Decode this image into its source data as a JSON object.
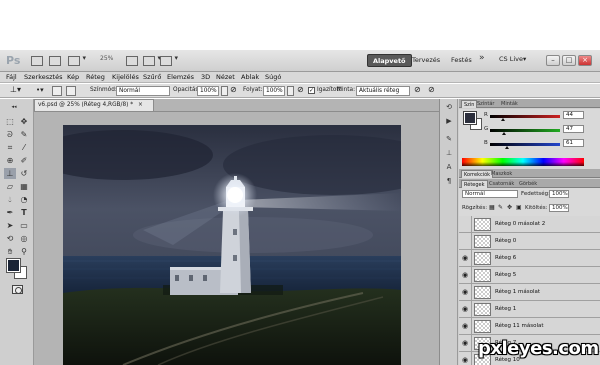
{
  "app": {
    "logo": "Ps",
    "zoom": "25%",
    "workspaces": [
      "Alapvető",
      "Tervezés",
      "Festés"
    ],
    "more": "»",
    "cslive": "CS Live▾",
    "win_buttons": [
      "–",
      "□",
      "×"
    ]
  },
  "menu": [
    "Fájl",
    "Szerkesztés",
    "Kép",
    "Réteg",
    "Kijelölés",
    "Szűrő",
    "Elemzés",
    "3D",
    "Nézet",
    "Ablak",
    "Súgó"
  ],
  "options": {
    "mode_label": "Színmód:",
    "mode_value": "Normál",
    "opacity_label": "Opacitás:",
    "opacity_value": "100%",
    "flow_label": "Folyat:",
    "flow_value": "100%",
    "aligned_label": "Igazított",
    "sample_label": "Minta:",
    "sample_value": "Aktuális réteg"
  },
  "document": {
    "tab_title": "v6.psd @ 25% (Réteg 4,RGB/8) *",
    "tab_close": "×"
  },
  "color_panel": {
    "tabs": [
      "Szín",
      "Színtár",
      "Minták"
    ],
    "channels": [
      {
        "label": "R",
        "value": "44"
      },
      {
        "label": "G",
        "value": "47"
      },
      {
        "label": "B",
        "value": "61"
      }
    ],
    "colors": {
      "r_track": "#cc2222",
      "g_track": "#22aa22",
      "b_track": "#2244cc"
    }
  },
  "adjust_tabs": [
    "Korrekciók",
    "Maszkok"
  ],
  "layers_panel": {
    "tabs": [
      "Rétegek",
      "Csatornák",
      "Görbék"
    ],
    "blend_mode": "Normál",
    "opacity_label": "Fedettség:",
    "opacity_value": "100%",
    "lock_label": "Rögzítés:",
    "fill_label": "Kitöltés:",
    "fill_value": "100%",
    "layers": [
      {
        "name": "Réteg 0 másolat 2",
        "visible": false
      },
      {
        "name": "Réteg 0",
        "visible": false
      },
      {
        "name": "Réteg 6",
        "visible": true
      },
      {
        "name": "Réteg 5",
        "visible": true
      },
      {
        "name": "Réteg 1 másolat",
        "visible": true
      },
      {
        "name": "Réteg 1",
        "visible": true
      },
      {
        "name": "Réteg 11 másolat",
        "visible": true
      },
      {
        "name": "Réteg 7",
        "visible": true
      },
      {
        "name": "Réteg 10",
        "visible": true
      }
    ]
  },
  "watermark": "pxleyes.com"
}
